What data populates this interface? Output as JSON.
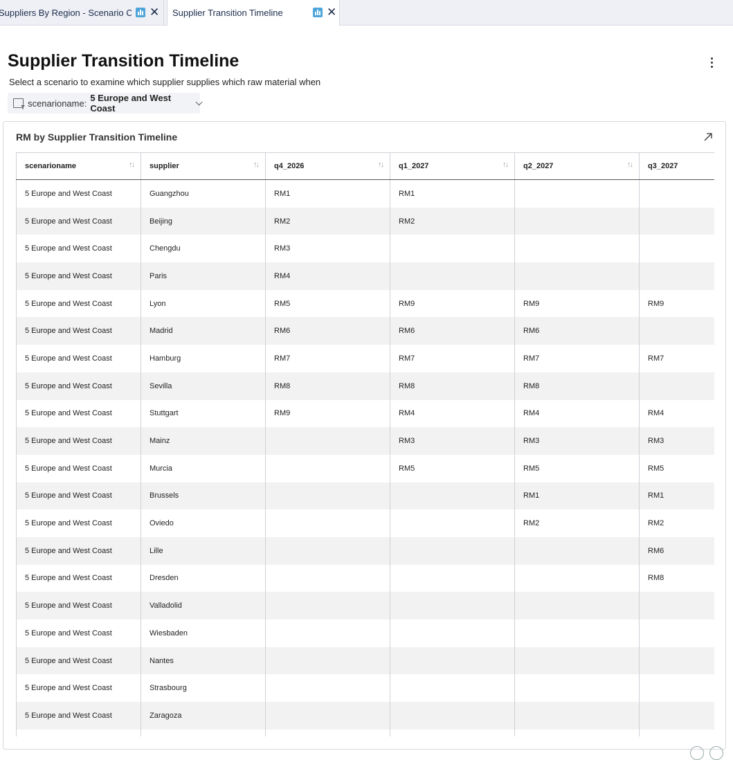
{
  "tabs": [
    {
      "label": "Suppliers By Region - Scenario Comparison",
      "icon": "bar-chart-icon"
    },
    {
      "label": "Supplier Transition Timeline",
      "icon": "bar-chart-icon"
    }
  ],
  "page": {
    "title": "Supplier Transition Timeline",
    "subtitle": "Select a scenario to examine which supplier supplies which raw material when"
  },
  "filter": {
    "name": "scenarioname:",
    "value": "5 Europe and West Coast"
  },
  "panel": {
    "title": "RM by Supplier Transition Timeline"
  },
  "table": {
    "columns": [
      "scenarioname",
      "supplier",
      "q4_2026",
      "q1_2027",
      "q2_2027",
      "q3_2027"
    ],
    "rows": [
      [
        "5 Europe and West Coast",
        "Guangzhou",
        "RM1",
        "RM1",
        "",
        ""
      ],
      [
        "5 Europe and West Coast",
        "Beijing",
        "RM2",
        "RM2",
        "",
        ""
      ],
      [
        "5 Europe and West Coast",
        "Chengdu",
        "RM3",
        "",
        "",
        ""
      ],
      [
        "5 Europe and West Coast",
        "Paris",
        "RM4",
        "",
        "",
        ""
      ],
      [
        "5 Europe and West Coast",
        "Lyon",
        "RM5",
        "RM9",
        "RM9",
        "RM9"
      ],
      [
        "5 Europe and West Coast",
        "Madrid",
        "RM6",
        "RM6",
        "RM6",
        ""
      ],
      [
        "5 Europe and West Coast",
        "Hamburg",
        "RM7",
        "RM7",
        "RM7",
        "RM7"
      ],
      [
        "5 Europe and West Coast",
        "Sevilla",
        "RM8",
        "RM8",
        "RM8",
        ""
      ],
      [
        "5 Europe and West Coast",
        "Stuttgart",
        "RM9",
        "RM4",
        "RM4",
        "RM4"
      ],
      [
        "5 Europe and West Coast",
        "Mainz",
        "",
        "RM3",
        "RM3",
        "RM3"
      ],
      [
        "5 Europe and West Coast",
        "Murcia",
        "",
        "RM5",
        "RM5",
        "RM5"
      ],
      [
        "5 Europe and West Coast",
        "Brussels",
        "",
        "",
        "RM1",
        "RM1"
      ],
      [
        "5 Europe and West Coast",
        "Oviedo",
        "",
        "",
        "RM2",
        "RM2"
      ],
      [
        "5 Europe and West Coast",
        "Lille",
        "",
        "",
        "",
        "RM6"
      ],
      [
        "5 Europe and West Coast",
        "Dresden",
        "",
        "",
        "",
        "RM8"
      ],
      [
        "5 Europe and West Coast",
        "Valladolid",
        "",
        "",
        "",
        ""
      ],
      [
        "5 Europe and West Coast",
        "Wiesbaden",
        "",
        "",
        "",
        ""
      ],
      [
        "5 Europe and West Coast",
        "Nantes",
        "",
        "",
        "",
        ""
      ],
      [
        "5 Europe and West Coast",
        "Strasbourg",
        "",
        "",
        "",
        ""
      ],
      [
        "5 Europe and West Coast",
        "Zaragoza",
        "",
        "",
        "",
        ""
      ],
      [
        "",
        "",
        "",
        "",
        "",
        ""
      ]
    ]
  },
  "colors": {
    "accent": "#4ea5d9",
    "row_alt": "#f2f2f2",
    "tabbar": "#eef0f5"
  }
}
